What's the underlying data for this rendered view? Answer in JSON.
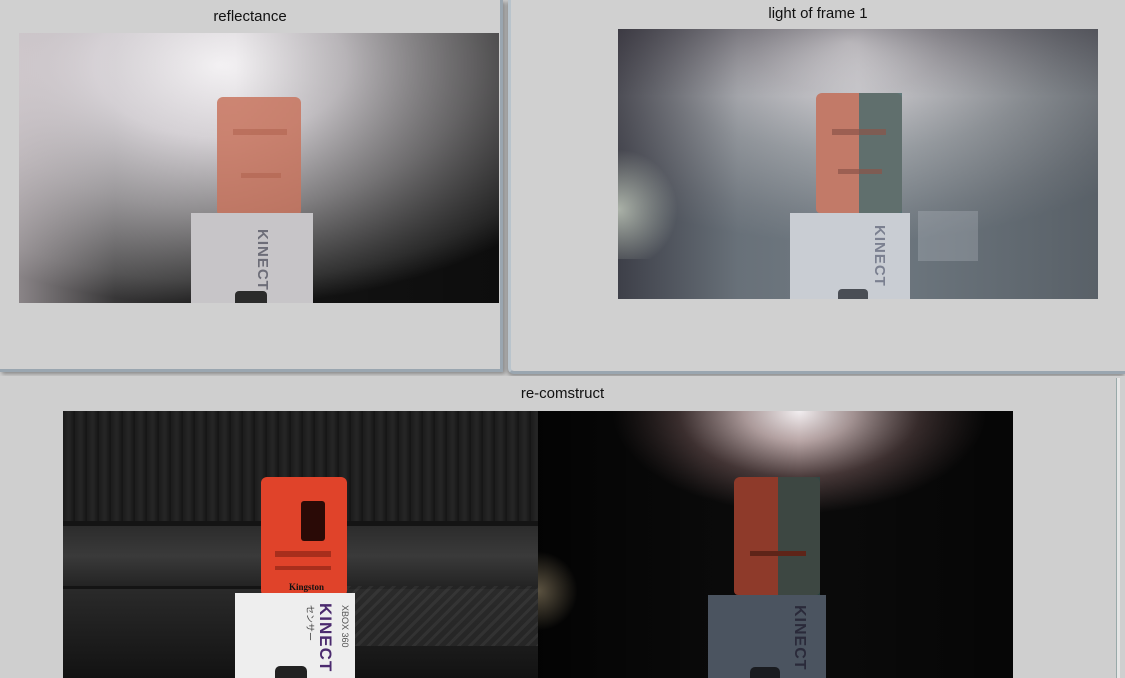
{
  "windows": {
    "reflectance": {
      "title": "reflectance"
    },
    "light": {
      "title": "light of frame 1"
    },
    "reconstruct": {
      "title": "re-comstruct"
    }
  },
  "product_box": {
    "brand": "KINECT",
    "subtitle": "XBOX 360",
    "japanese": "センサー",
    "statue_label": "Kingston"
  }
}
